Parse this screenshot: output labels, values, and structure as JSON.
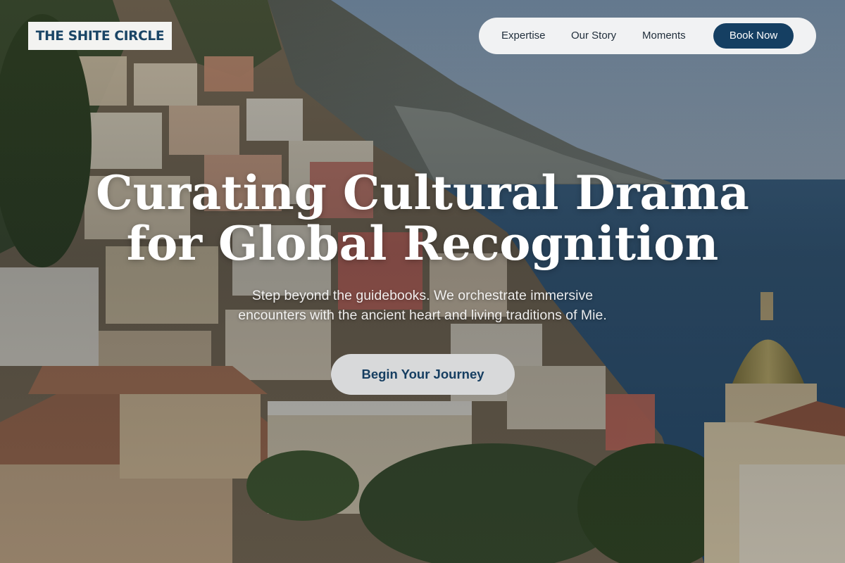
{
  "brand": {
    "name": "THE SHITE CIRCLE"
  },
  "nav": {
    "links": [
      "Expertise",
      "Our Story",
      "Moments"
    ],
    "cta_label": "Book Now"
  },
  "hero": {
    "headline_line1": "Curating Cultural Drama",
    "headline_line2": "for Global Recognition",
    "subline_line1": "Step beyond the guidebooks. We orchestrate immersive",
    "subline_line2": "encounters with the ancient heart and living traditions of Mie.",
    "cta_label": "Begin Your Journey",
    "background": "coastal-hillside-town-photo"
  },
  "colors": {
    "brand_navy": "#153f62",
    "nav_bg": "#f7f7f7",
    "cta_bg": "#d8d9da",
    "text_white": "#ffffff"
  }
}
